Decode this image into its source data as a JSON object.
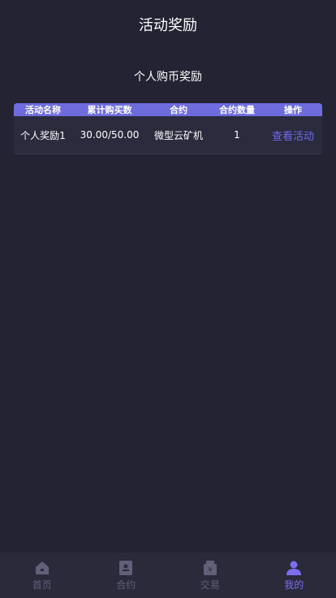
{
  "header": {
    "title": "活动奖励"
  },
  "section": {
    "title": "个人购币奖励"
  },
  "table": {
    "columns": [
      "活动名称",
      "累计购买数",
      "合约",
      "合约数量",
      "操作"
    ],
    "rows": [
      {
        "name": "个人奖励1",
        "progress": "30.00/50.00",
        "contract": "微型云矿机",
        "quantity": "1",
        "action": "查看活动"
      }
    ]
  },
  "tabbar": {
    "items": [
      {
        "label": "首页",
        "icon": "home-icon",
        "active": false
      },
      {
        "label": "合约",
        "icon": "contract-icon",
        "active": false
      },
      {
        "label": "交易",
        "icon": "trade-icon",
        "active": false
      },
      {
        "label": "我的",
        "icon": "profile-icon",
        "active": true
      }
    ],
    "colors": {
      "inactive": "#60607a",
      "active": "#7a6df0"
    }
  }
}
